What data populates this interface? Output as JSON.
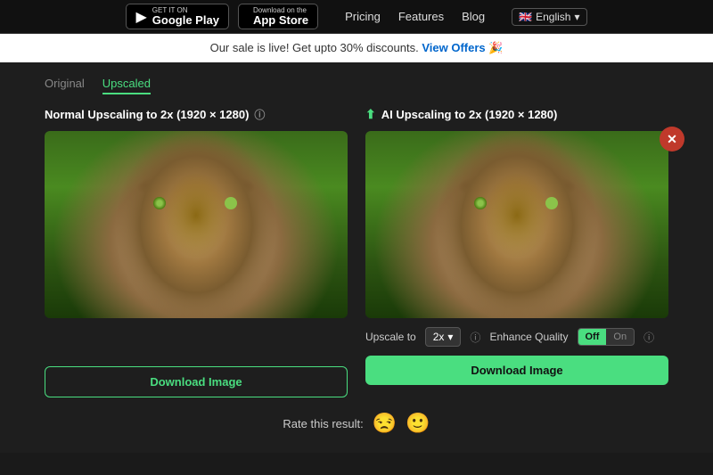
{
  "nav": {
    "google_play_top": "GET IT ON",
    "google_play_bottom": "Google Play",
    "app_store_top": "Download on the",
    "app_store_bottom": "App Store",
    "links": [
      "Pricing",
      "Features",
      "Blog"
    ],
    "language": "English"
  },
  "promo": {
    "text": "Our sale is live! Get upto 30% discounts.",
    "link_text": "View Offers 🎉"
  },
  "tabs": {
    "items": [
      "Original",
      "Upscaled"
    ],
    "active": "Upscaled"
  },
  "left_panel": {
    "title": "Normal Upscaling to 2x (1920 × 1280)",
    "download_label": "Download Image"
  },
  "right_panel": {
    "title": "AI Upscaling to 2x (1920 × 1280)",
    "upscale_label": "Upscale to",
    "upscale_value": "2x",
    "enhance_label": "Enhance Quality",
    "toggle_off": "Off",
    "toggle_on": "On",
    "download_label": "Download Image"
  },
  "rating": {
    "label": "Rate this result:",
    "bad_emoji": "😒",
    "good_emoji": "🙂"
  },
  "close_icon": "✕"
}
